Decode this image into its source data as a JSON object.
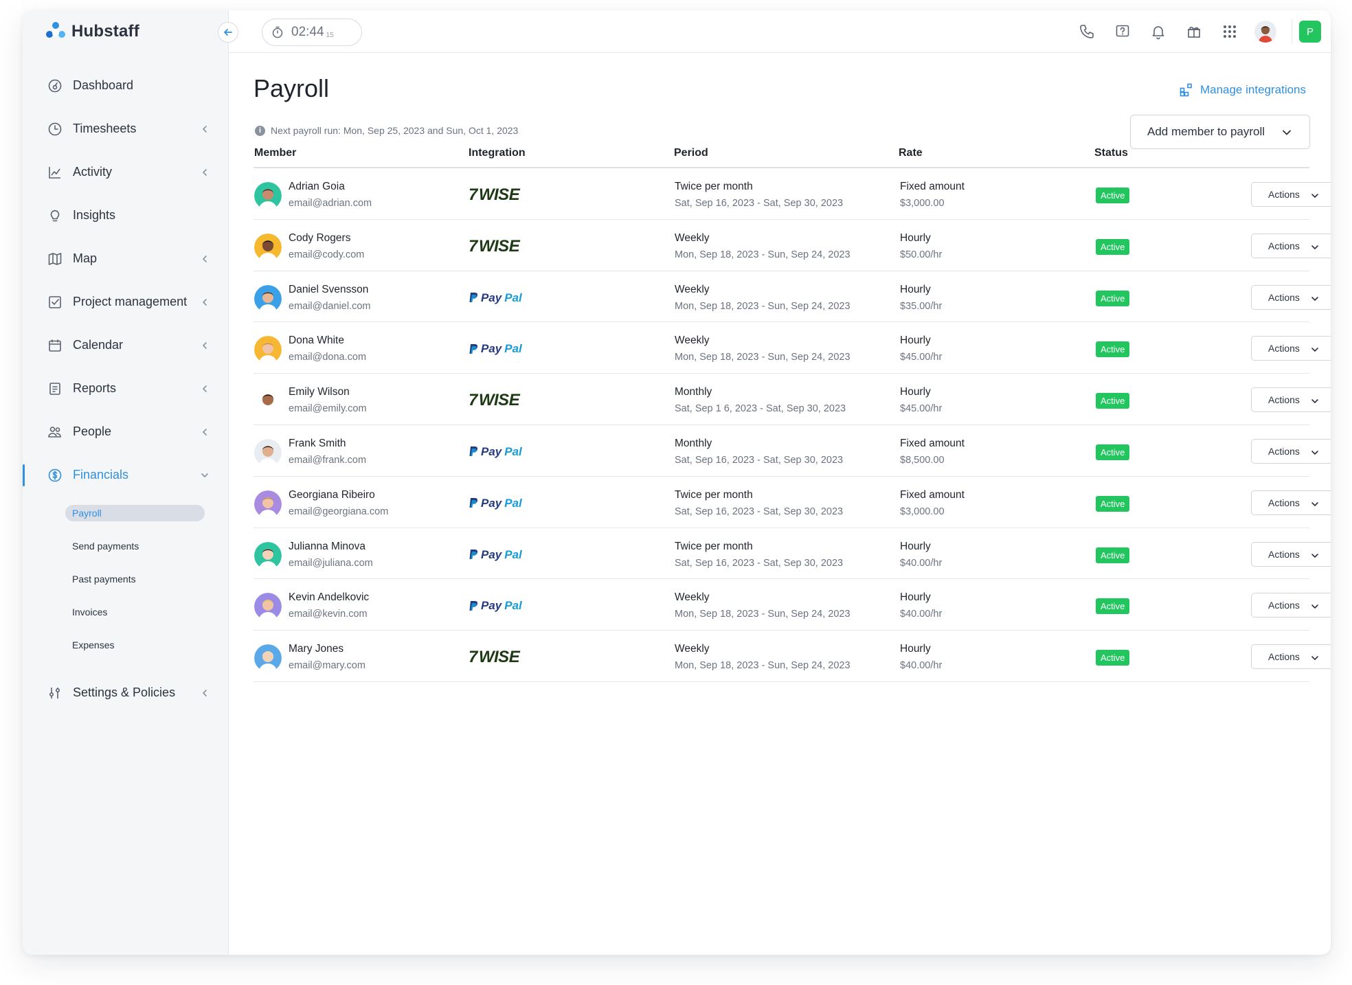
{
  "app": {
    "logo_text": "Hubstaff"
  },
  "timer": {
    "value": "02:44",
    "seconds": "15"
  },
  "user": {
    "org_initial": "P"
  },
  "sidebar": {
    "items": [
      {
        "label": "Dashboard",
        "icon": "dashboard-icon",
        "has_chevron": false
      },
      {
        "label": "Timesheets",
        "icon": "clock-icon",
        "has_chevron": true
      },
      {
        "label": "Activity",
        "icon": "activity-chart-icon",
        "has_chevron": true
      },
      {
        "label": "Insights",
        "icon": "lightbulb-icon",
        "has_chevron": false
      },
      {
        "label": "Map",
        "icon": "map-icon",
        "has_chevron": true
      },
      {
        "label": "Project management",
        "icon": "checkbox-icon",
        "has_chevron": true
      },
      {
        "label": "Calendar",
        "icon": "calendar-icon",
        "has_chevron": true
      },
      {
        "label": "Reports",
        "icon": "reports-icon",
        "has_chevron": true
      },
      {
        "label": "People",
        "icon": "people-icon",
        "has_chevron": true
      },
      {
        "label": "Financials",
        "icon": "dollar-circle-icon",
        "has_chevron": true,
        "active": true
      }
    ],
    "financials_sub": [
      "Payroll",
      "Send payments",
      "Past payments",
      "Invoices",
      "Expenses"
    ],
    "settings": {
      "label": "Settings & Policies",
      "icon": "sliders-icon"
    }
  },
  "page": {
    "title": "Payroll",
    "manage_integrations": "Manage integrations",
    "next_run": "Next payroll run: Mon, Sep 25, 2023 and Sun, Oct 1, 2023",
    "add_member": "Add member to payroll"
  },
  "table": {
    "headers": {
      "member": "Member",
      "integration": "Integration",
      "period": "Period",
      "rate": "Rate",
      "status": "Status"
    },
    "rows": [
      {
        "name": "Adrian Goia",
        "email": "email@adrian.com",
        "integration": "wise",
        "period": "Twice per month",
        "range": "Sat, Sep 16, 2023 - Sat, Sep 30, 2023",
        "rate_type": "Fixed amount",
        "rate": "$3,000.00",
        "status": "Active",
        "action": "Actions",
        "avatar_bg": "#2ec4a0",
        "avatar_skin": "#c98b6b",
        "avatar_hair": "#3a2a22"
      },
      {
        "name": "Cody Rogers",
        "email": "email@cody.com",
        "integration": "wise",
        "period": "Weekly",
        "range": "Mon, Sep 18, 2023 - Sun, Sep 24, 2023",
        "rate_type": "Hourly",
        "rate": "$50.00/hr",
        "status": "Active",
        "action": "Actions",
        "avatar_bg": "#f5b82e",
        "avatar_skin": "#7a4a32",
        "avatar_hair": "#1f1a17"
      },
      {
        "name": "Daniel Svensson",
        "email": "email@daniel.com",
        "integration": "paypal",
        "period": "Weekly",
        "range": "Mon, Sep 18, 2023 - Sun, Sep 24, 2023",
        "rate_type": "Hourly",
        "rate": "$35.00/hr",
        "status": "Active",
        "action": "Actions",
        "avatar_bg": "#3aa0e8",
        "avatar_skin": "#e8b896",
        "avatar_hair": "#2b2520"
      },
      {
        "name": "Dona White",
        "email": "email@dona.com",
        "integration": "paypal",
        "period": "Weekly",
        "range": "Mon, Sep 18, 2023 - Sun, Sep 24, 2023",
        "rate_type": "Hourly",
        "rate": "$45.00/hr",
        "status": "Active",
        "action": "Actions",
        "avatar_bg": "#f7b733",
        "avatar_skin": "#f0c4a4",
        "avatar_hair": "#c98a3a"
      },
      {
        "name": "Emily Wilson",
        "email": "email@emily.com",
        "integration": "wise",
        "period": "Monthly",
        "range": "Sat, Sep 1  6, 2023 - Sat, Sep 30, 2023",
        "rate_type": "Hourly",
        "rate": "$45.00/hr",
        "status": "Active",
        "action": "Actions",
        "avatar_bg": "#ffffff",
        "avatar_skin": "#a86b4a",
        "avatar_hair": "#1f1a17"
      },
      {
        "name": "Frank Smith",
        "email": "email@frank.com",
        "integration": "paypal",
        "period": "Monthly",
        "range": "Sat, Sep 16, 2023 - Sat, Sep 30, 2023",
        "rate_type": "Fixed amount",
        "rate": "$8,500.00",
        "status": "Active",
        "action": "Actions",
        "avatar_bg": "#e9edf2",
        "avatar_skin": "#e0b08e",
        "avatar_hair": "#2b2520"
      },
      {
        "name": "Georgiana Ribeiro",
        "email": "email@georgiana.com",
        "integration": "paypal",
        "period": "Twice per month",
        "range": "Sat, Sep 16, 2023 - Sat, Sep 30, 2023",
        "rate_type": "Fixed amount",
        "rate": "$3,000.00",
        "status": "Active",
        "action": "Actions",
        "avatar_bg": "#a98be0",
        "avatar_skin": "#f0c4a4",
        "avatar_hair": "#b78a5a"
      },
      {
        "name": "Julianna Minova",
        "email": "email@juliana.com",
        "integration": "paypal",
        "period": "Twice per month",
        "range": "Sat, Sep 16, 2023 - Sat, Sep 30, 2023",
        "rate_type": "Hourly",
        "rate": "$40.00/hr",
        "status": "Active",
        "action": "Actions",
        "avatar_bg": "#2ec4a0",
        "avatar_skin": "#f3d3b8",
        "avatar_hair": "#2b2018"
      },
      {
        "name": "Kevin Andelkovic",
        "email": "email@kevin.com",
        "integration": "paypal",
        "period": "Weekly",
        "range": "Mon, Sep 18, 2023 - Sun, Sep 24, 2023",
        "rate_type": "Hourly",
        "rate": "$40.00/hr",
        "status": "Active",
        "action": "Actions",
        "avatar_bg": "#9b8ae6",
        "avatar_skin": "#f0c4a4",
        "avatar_hair": "#e7c25a"
      },
      {
        "name": "Mary Jones",
        "email": "email@mary.com",
        "integration": "wise",
        "period": "Weekly",
        "range": "Mon, Sep 18, 2023 - Sun, Sep 24, 2023",
        "rate_type": "Hourly",
        "rate": "$40.00/hr",
        "status": "Active",
        "action": "Actions",
        "avatar_bg": "#5aa8e8",
        "avatar_skin": "#f3d3b8",
        "avatar_hair": "#e8d9b0"
      }
    ]
  },
  "integration_labels": {
    "wise": "WISE",
    "paypal_1": "Pay",
    "paypal_2": "Pal"
  },
  "colors": {
    "accent": "#2f8fe0",
    "status_active": "#22c55e",
    "wise_green": "#1d3a14",
    "paypal_dark": "#253b80",
    "paypal_light": "#179bd7"
  }
}
